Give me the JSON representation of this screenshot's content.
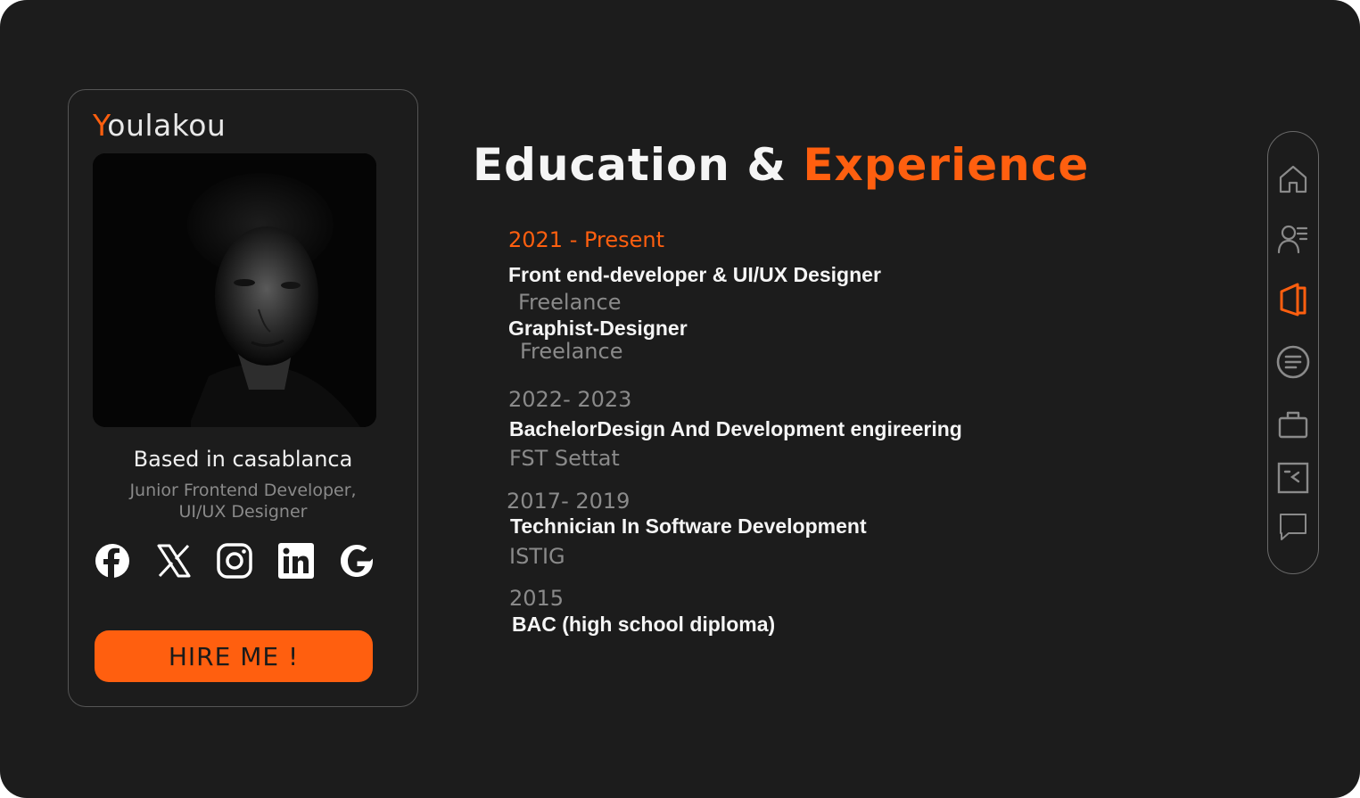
{
  "profile": {
    "brand_first_letter": "Y",
    "brand_rest": "oulakou",
    "based": "Based in casablanca",
    "role_line1": "Junior Frontend Developer,",
    "role_line2": "UI/UX Designer",
    "hire_label": "HIRE  ME !",
    "socials": [
      "facebook-icon",
      "x-icon",
      "instagram-icon",
      "linkedin-icon",
      "google-icon"
    ]
  },
  "main": {
    "heading_part1": "Education & ",
    "heading_part2": "Experience",
    "entries": [
      {
        "year": "2021 - Present",
        "items": [
          {
            "title": "Front end-developer & UI/UX Designer",
            "org": "Freelance"
          },
          {
            "title": "Graphist-Designer",
            "org": "Freelance"
          }
        ]
      },
      {
        "year": "2022- 2023",
        "title": "BachelorDesign And  Development  engireering",
        "org": "FST Settat"
      },
      {
        "year": "2017- 2019",
        "title": "Technician  In  Software  Development",
        "org": "ISTIG"
      },
      {
        "year": "2015",
        "title": "BAC (high school diploma)"
      }
    ]
  },
  "nav": {
    "items": [
      "home-icon",
      "profile-icon",
      "resume-icon",
      "services-icon",
      "portfolio-icon",
      "blog-icon",
      "contact-icon"
    ],
    "active": "resume-icon"
  },
  "colors": {
    "accent": "#ff5f0f",
    "background": "#1c1c1c",
    "muted_text": "#8a8a8a",
    "text": "#f5f5f5"
  }
}
